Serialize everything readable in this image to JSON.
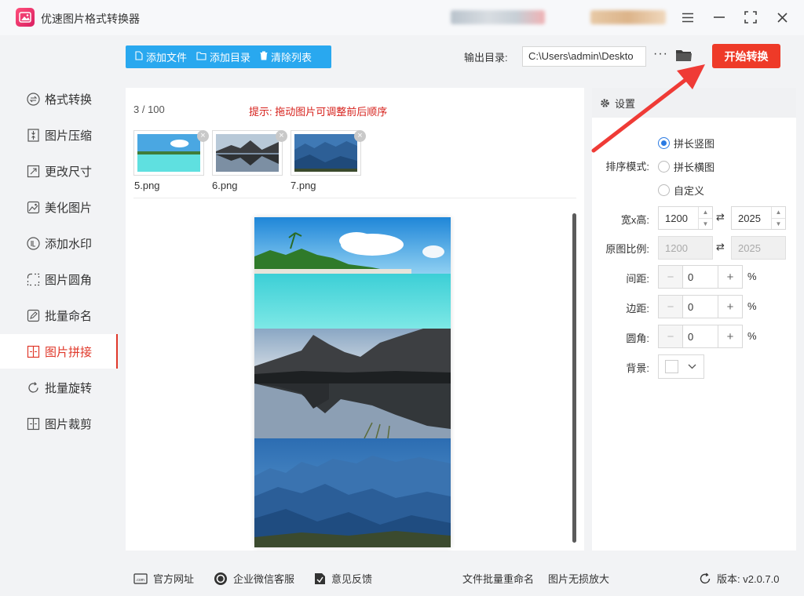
{
  "app": {
    "title": "优速图片格式转换器",
    "accent": "#ee3a28",
    "toolbar_color": "#29a8ef"
  },
  "window": {
    "menu_icon": "menu-icon",
    "minimize_icon": "minimize-icon",
    "maximize_icon": "maximize-icon",
    "close_icon": "close-icon"
  },
  "sidebar": {
    "items": [
      {
        "label": "格式转换",
        "icon": "format-convert-icon"
      },
      {
        "label": "图片压缩",
        "icon": "compress-icon"
      },
      {
        "label": "更改尺寸",
        "icon": "resize-icon"
      },
      {
        "label": "美化图片",
        "icon": "beautify-icon"
      },
      {
        "label": "添加水印",
        "icon": "watermark-icon"
      },
      {
        "label": "图片圆角",
        "icon": "round-corner-icon"
      },
      {
        "label": "批量命名",
        "icon": "rename-icon"
      },
      {
        "label": "图片拼接",
        "icon": "stitch-icon",
        "active": true
      },
      {
        "label": "批量旋转",
        "icon": "rotate-icon"
      },
      {
        "label": "图片裁剪",
        "icon": "crop-icon"
      }
    ]
  },
  "toolbar": {
    "add_file": "添加文件",
    "add_folder": "添加目录",
    "clear_list": "清除列表"
  },
  "output": {
    "label": "输出目录:",
    "path": "C:\\Users\\admin\\Deskto",
    "more": "···"
  },
  "start_button": "开始转换",
  "file_list": {
    "count": "3 / 100",
    "hint": "提示: 拖动图片可调整前后顺序",
    "files": [
      {
        "name": "5.png"
      },
      {
        "name": "6.png"
      },
      {
        "name": "7.png"
      }
    ]
  },
  "settings": {
    "header": "设置",
    "sort_mode_label": "排序模式:",
    "sort_options": [
      {
        "label": "拼长竖图",
        "selected": true
      },
      {
        "label": "拼长横图",
        "selected": false
      },
      {
        "label": "自定义",
        "selected": false
      }
    ],
    "size_label": "宽x高:",
    "width": "1200",
    "height": "2025",
    "ratio_label": "原图比例:",
    "ratio_width": "1200",
    "ratio_height": "2025",
    "spacing_label": "间距:",
    "spacing_value": "0",
    "margin_label": "边距:",
    "margin_value": "0",
    "radius_label": "圆角:",
    "radius_value": "0",
    "percent": "%",
    "background_label": "背景:",
    "background_color": "#ffffff"
  },
  "bottom": {
    "website": "官方网址",
    "wechat": "企业微信客服",
    "feedback": "意见反馈",
    "batch_rename": "文件批量重命名",
    "lossless": "图片无损放大",
    "version": "版本: v2.0.7.0"
  }
}
